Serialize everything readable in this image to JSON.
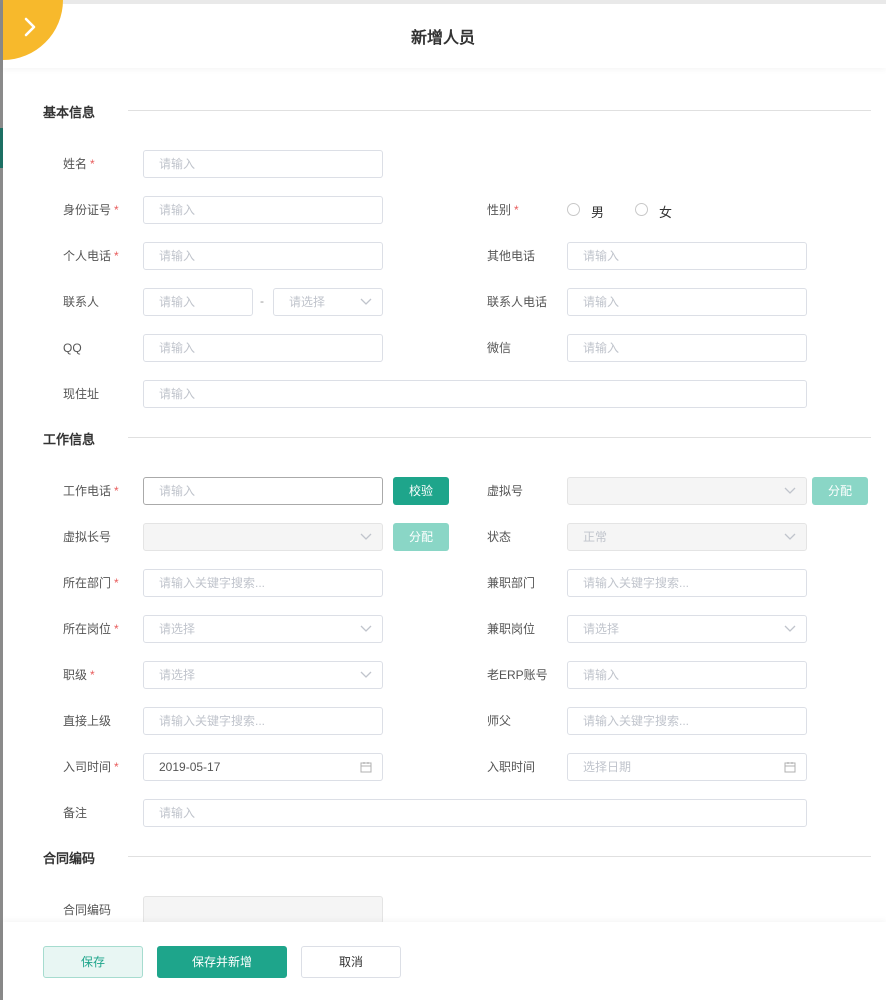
{
  "title": "新增人员",
  "sections": {
    "basic": "基本信息",
    "work": "工作信息",
    "contract": "合同编码"
  },
  "fields": {
    "name": {
      "label": "姓名",
      "placeholder": "请输入"
    },
    "idcard": {
      "label": "身份证号",
      "placeholder": "请输入"
    },
    "gender": {
      "label": "性别",
      "options": [
        "男",
        "女"
      ]
    },
    "phone": {
      "label": "个人电话",
      "placeholder": "请输入"
    },
    "other_phone": {
      "label": "其他电话",
      "placeholder": "请输入"
    },
    "contact": {
      "label": "联系人",
      "placeholder": "请输入",
      "select_placeholder": "请选择",
      "separator": "-"
    },
    "contact_phone": {
      "label": "联系人电话",
      "placeholder": "请输入"
    },
    "qq": {
      "label": "QQ",
      "placeholder": "请输入"
    },
    "wechat": {
      "label": "微信",
      "placeholder": "请输入"
    },
    "address": {
      "label": "现住址",
      "placeholder": "请输入"
    },
    "work_phone": {
      "label": "工作电话",
      "placeholder": "请输入",
      "button": "校验"
    },
    "virtual_no": {
      "label": "虚拟号",
      "button": "分配"
    },
    "virtual_long": {
      "label": "虚拟长号",
      "button": "分配"
    },
    "status": {
      "label": "状态",
      "value": "正常"
    },
    "department": {
      "label": "所在部门",
      "placeholder": "请输入关键字搜索..."
    },
    "part_department": {
      "label": "兼职部门",
      "placeholder": "请输入关键字搜索..."
    },
    "position": {
      "label": "所在岗位",
      "placeholder": "请选择"
    },
    "part_position": {
      "label": "兼职岗位",
      "placeholder": "请选择"
    },
    "rank": {
      "label": "职级",
      "placeholder": "请选择"
    },
    "old_erp": {
      "label": "老ERP账号",
      "placeholder": "请输入"
    },
    "superior": {
      "label": "直接上级",
      "placeholder": "请输入关键字搜索..."
    },
    "mentor": {
      "label": "师父",
      "placeholder": "请输入关键字搜索..."
    },
    "join_date": {
      "label": "入司时间",
      "value": "2019-05-17"
    },
    "entry_date": {
      "label": "入职时间",
      "placeholder": "选择日期"
    },
    "remark": {
      "label": "备注",
      "placeholder": "请输入"
    },
    "contract_code": {
      "label": "合同编码"
    }
  },
  "required_mark": "*",
  "footer": {
    "save": "保存",
    "save_new": "保存并新增",
    "cancel": "取消"
  },
  "colors": {
    "accent": "#1ea58b",
    "accent_light": "#8ad6c6",
    "corner": "#f7b92c",
    "required": "#e85c5c"
  }
}
